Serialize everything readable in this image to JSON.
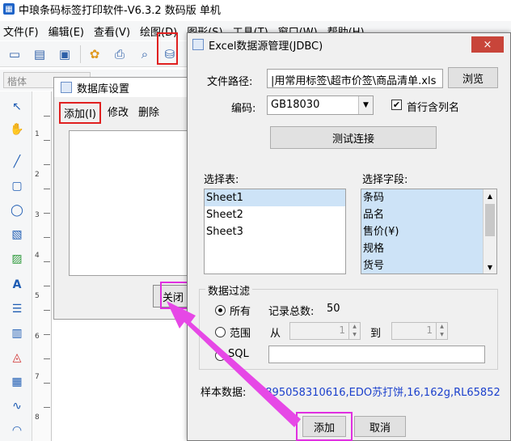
{
  "app": {
    "title": "中琅条码标签打印软件-V6.3.2 数码版 单机",
    "menu": [
      "文件(F)",
      "编辑(E)",
      "查看(V)",
      "绘图(D)",
      "图形(S)",
      "工具(T)",
      "窗口(W)",
      "帮助(H)"
    ],
    "font_placeholder": "楷体",
    "ruler_numbers": [
      "1",
      "2",
      "3",
      "4",
      "5",
      "6",
      "7",
      "8"
    ]
  },
  "db_settings": {
    "title": "数据库设置",
    "menu": {
      "add": "添加(I)",
      "modify": "修改",
      "delete": "删除"
    },
    "close": "关闭"
  },
  "excel_dialog": {
    "title": "Excel数据源管理(JDBC)",
    "close_icon": "×",
    "path_label": "文件路径:",
    "path_value": "|用常用标签\\超市价签\\商品清单.xls",
    "browse": "浏览",
    "encoding_label": "编码:",
    "encoding_value": "GB18030",
    "header_checkbox_label": "首行含列名",
    "header_checked": true,
    "test_connection": "测试连接",
    "table_label": "选择表:",
    "tables": [
      "Sheet1",
      "Sheet2",
      "Sheet3"
    ],
    "selected_table": "Sheet1",
    "field_label": "选择字段:",
    "fields": [
      "条码",
      "品名",
      "售价(¥)",
      "规格",
      "货号"
    ],
    "filter_label": "数据过滤",
    "all_label": "所有",
    "record_count_label": "记录总数:",
    "record_count": "50",
    "range_label": "范围",
    "from_label": "从",
    "from_value": "1",
    "to_label": "到",
    "to_value": "1",
    "sql_label": "SQL",
    "sample_label": "样本数据:",
    "sample_value": "4895058310616,EDO苏打饼,16,162g,RL65852",
    "add": "添加",
    "cancel": "取消"
  },
  "colors": {
    "highlight_red": "#e02020",
    "highlight_pink": "#e030e0",
    "sample_text": "#1a3fcc"
  }
}
